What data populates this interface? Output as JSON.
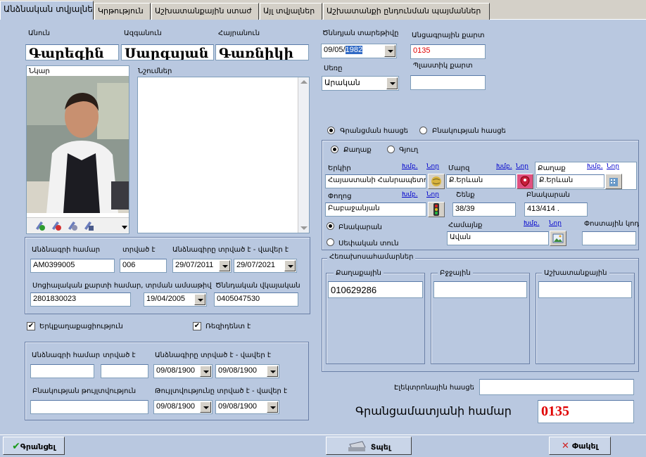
{
  "tabs": [
    {
      "label": "Անձնական տվյալներ"
    },
    {
      "label": "Կրթություն"
    },
    {
      "label": "Աշխատանքային ստաժ"
    },
    {
      "label": "Այլ տվյալներ"
    },
    {
      "label": "Աշխատանքի ընդունման պայմաններ"
    }
  ],
  "person": {
    "name_label": "Անուն",
    "name": "Գարեգին",
    "surname_label": "Ազգանուն",
    "surname": "Սարգսյան",
    "patronymic_label": "Հայրանուն",
    "patronymic": "Գառնիկի",
    "photo_label": "Նկար",
    "notes_label": "Նշումներ",
    "birthdate_label": "Ծննդյան տարեթիվը",
    "birthdate_prefix": "09/05/",
    "birthdate_year": "1982",
    "passcard_label": "Անցագրային քարտ",
    "passcard": "0135",
    "gender_label": "Սեռը",
    "gender": "Արական",
    "plastic_label": "Պլաստիկ քարտ",
    "plastic": ""
  },
  "passport": {
    "number_label": "Անձնագրի համար",
    "number": "AM0399005",
    "issued_label": "տրված է",
    "issued": "006",
    "dates_label": "Անձնագիրը տրված է - վավեր է",
    "date_from": "29/07/2011",
    "date_to": "29/07/2021",
    "ssn_label": "Սոցիալական քարտի համար, տրման ամսաթիվ",
    "ssn": "2801830023",
    "ssn_date": "19/04/2005",
    "birthcert_label": "Ծննդական վկայական",
    "birthcert": "0405047530"
  },
  "checkboxes": {
    "dual": "Երկքաղաքացիություն",
    "dual_checked": "✔",
    "residence": "Ռեզիդենտ է",
    "residence_checked": "✔"
  },
  "passport2": {
    "number_label": "Անձնագրի համար",
    "issued_label": "տրված է",
    "dates_label": "Անձնագիրը տրված է - վավեր է",
    "date_from": "09/08/1900",
    "date_to": "09/08/1900",
    "permit_label": "Բնակության թույլտվություն",
    "permit_dates_label": "Թույլտվությունը տրված է - վավեր է",
    "permit_from": "09/08/1900",
    "permit_to": "09/08/1900"
  },
  "address": {
    "radio_reg": "Գրանցման հասցե",
    "radio_res": "Բնակության հասցե",
    "radio_city": "Քաղաք",
    "radio_village": "Գյուղ",
    "country_label": "Երկիր",
    "country": "Հայաստանի Հանրապետություն",
    "region_label": "Մարզ",
    "region": "Ք.Երևան",
    "city_label": "Քաղաք",
    "city": "Ք.Երևան",
    "street_label": "Փողոց",
    "street": "Բաբաջանյան",
    "building_label": "Շենք",
    "building": "38/39",
    "apt_label": "Բնակարան",
    "apt": "413/414 .",
    "radio_apt": "Բնակարան",
    "radio_house": "Սեփական տուն",
    "community_label": "Համայնք",
    "community": "Ավան",
    "postal_label": "Փոստային կոդ",
    "postal": "",
    "edit": "Խմբ.",
    "new": "Նոր"
  },
  "phones": {
    "group": "Հեռախոսահամարներ",
    "city_label": "Քաղաքային",
    "city": "010629286",
    "mobile_label": "Բջջային",
    "work_label": "Աշխատանքային"
  },
  "email_label": "Էլեկտրոնային հասցե",
  "reg_label": "Գրանցամատյանի համար",
  "reg": "0135",
  "buttons": {
    "register": "Գրանցել",
    "print": "Տպել",
    "close": "Փակել"
  }
}
